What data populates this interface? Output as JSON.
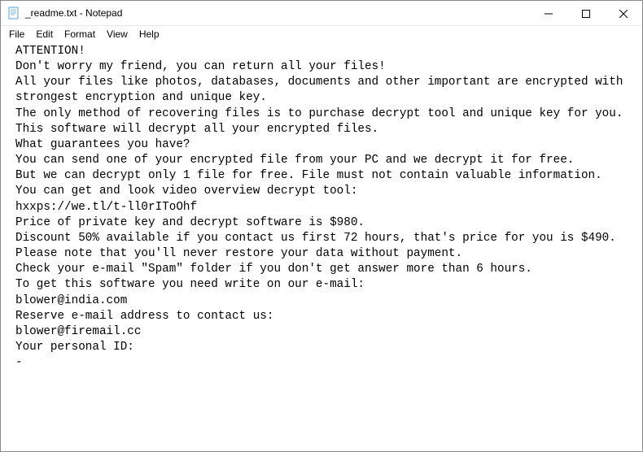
{
  "titlebar": {
    "filename": "_readme.txt",
    "app": "Notepad",
    "full_title": "_readme.txt - Notepad"
  },
  "window_controls": {
    "minimize": "Minimize",
    "maximize": "Maximize",
    "close": "Close"
  },
  "menubar": {
    "file": "File",
    "edit": "Edit",
    "format": "Format",
    "view": "View",
    "help": "Help"
  },
  "body_text": "ATTENTION!\nDon't worry my friend, you can return all your files!\nAll your files like photos, databases, documents and other important are encrypted with strongest encryption and unique key.\nThe only method of recovering files is to purchase decrypt tool and unique key for you.\nThis software will decrypt all your encrypted files.\nWhat guarantees you have?\nYou can send one of your encrypted file from your PC and we decrypt it for free.\nBut we can decrypt only 1 file for free. File must not contain valuable information.\nYou can get and look video overview decrypt tool:\nhxxps://we.tl/t-ll0rIToOhf\nPrice of private key and decrypt software is $980.\nDiscount 50% available if you contact us first 72 hours, that's price for you is $490.\nPlease note that you'll never restore your data without payment.\nCheck your e-mail \"Spam\" folder if you don't get answer more than 6 hours.\nTo get this software you need write on our e-mail:\nblower@india.com\nReserve e-mail address to contact us:\nblower@firemail.cc\nYour personal ID:\n-"
}
